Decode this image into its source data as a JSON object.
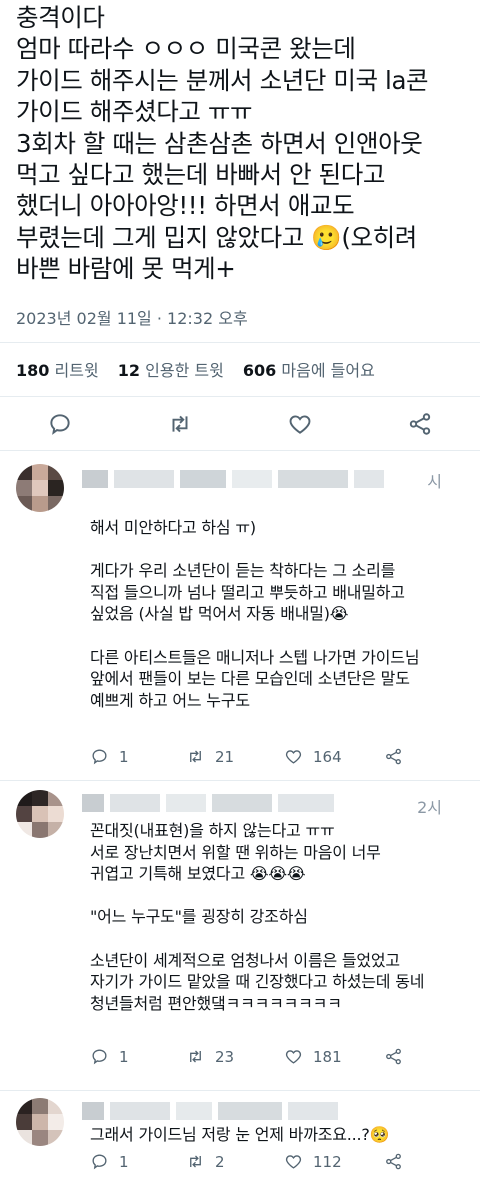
{
  "tweet": {
    "lines": [
      "충격이다",
      "엄마 따라수 ㅇㅇㅇ 미국콘 왔는데",
      "가이드 해주시는 분께서 소년단 미국 la콘",
      "가이드 해주셨다고 ㅠㅠ",
      "3회차 할 때는 삼촌삼촌 하면서 인앤아웃",
      "먹고 싶다고 했는데 바빠서 안 된다고",
      "했더니 아아아앙!!! 하면서 애교도",
      "부렸는데 그게 밉지 않았다고 🥲(오히려",
      "바쁜 바람에 못 먹게+"
    ],
    "timestamp": "2023년 02월 11일 · 12:32 오후",
    "stats": {
      "retweets_count": "180",
      "retweets_label": "리트윗",
      "quotes_count": "12",
      "quotes_label": "인용한 트윗",
      "likes_count": "606",
      "likes_label": "마음에 들어요"
    }
  },
  "replies": [
    {
      "time": "시",
      "lines": [
        "해서 미안하다고 하심 ㅠ)",
        "",
        "게다가 우리 소년단이 듣는 착하다는 그 소리를",
        "직접 들으니까 넘나 떨리고 뿌듯하고 배내밀하고",
        "싶었음 (사실 밥 먹어서 자동 배내밀)😭",
        "",
        "다른 아티스트들은 매니저나 스텝 나가면 가이드님",
        "앞에서 팬들이 보는 다른 모습인데 소년단은 말도",
        "예쁘게 하고 어느 누구도"
      ],
      "replies_count": "1",
      "retweets_count": "21",
      "likes_count": "164"
    },
    {
      "time": "2시",
      "lines": [
        "꼰대짓(내표현)을 하지 않는다고 ㅠㅠ",
        "서로 장난치면서 위할 땐 위하는 마음이 너무",
        "귀엽고 기특해 보였다고 😭😭😭",
        "",
        "\"어느 누구도\"를 굉장히 강조하심",
        "",
        "소년단이 세계적으로 엄청나서 이름은 들었었고",
        "자기가 가이드 맡았을 때 긴장했다고 하셨는데 동네",
        "청년들처럼 편안했댘ㅋㅋㅋㅋㅋㅋㅋㅋ"
      ],
      "replies_count": "1",
      "retweets_count": "23",
      "likes_count": "181"
    },
    {
      "time": "",
      "lines": [
        "그래서 가이드님 저랑 눈 언제 바까조요...?🥺"
      ],
      "replies_count": "1",
      "retweets_count": "2",
      "likes_count": "112"
    }
  ],
  "icons": {
    "reply": "reply-icon",
    "retweet": "retweet-icon",
    "like": "heart-icon",
    "share": "share-icon"
  },
  "colors": {
    "text": "#0f1419",
    "secondary": "#536471",
    "divider": "#e6ecf0"
  }
}
